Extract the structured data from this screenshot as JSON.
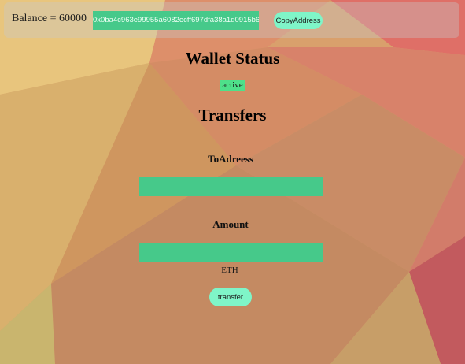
{
  "header": {
    "balance_text": "Balance = 60000",
    "address": "0x0ba4c963e99955a6082ecff697dfa38a1d0915b6",
    "copy_button_label": "CopyAddress"
  },
  "wallet": {
    "title": "Wallet Status",
    "status": "active"
  },
  "transfers": {
    "title": "Transfers",
    "to_label": "ToAdreess",
    "to_value": "",
    "amount_label": "Amount",
    "amount_value": "",
    "unit": "ETH",
    "transfer_button_label": "transfer"
  },
  "colors": {
    "field_green": "#46c98a",
    "button_mint": "#7ff5c8",
    "status_green": "#4ee08a"
  }
}
